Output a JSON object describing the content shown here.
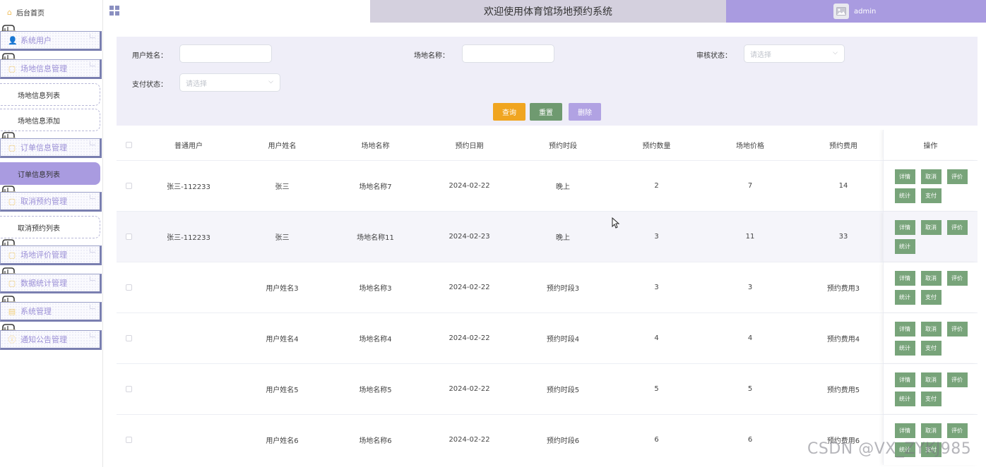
{
  "sidebar": {
    "home_label": "后台首页",
    "menus": [
      {
        "title": "系统用户",
        "icon": "user-icon",
        "items": []
      },
      {
        "title": "场地信息管理",
        "icon": "document-icon",
        "items": [
          "场地信息列表",
          "场地信息添加"
        ]
      },
      {
        "title": "订单信息管理",
        "icon": "document-icon",
        "items": [
          "订单信息列表"
        ]
      },
      {
        "title": "取消预约管理",
        "icon": "document-icon",
        "items": [
          "取消预约列表"
        ]
      },
      {
        "title": "场地评价管理",
        "icon": "document-icon",
        "items": []
      },
      {
        "title": "数据统计管理",
        "icon": "document-icon",
        "items": []
      },
      {
        "title": "系统管理",
        "icon": "grid-icon",
        "items": []
      },
      {
        "title": "通知公告管理",
        "icon": "info-icon",
        "items": []
      }
    ],
    "active_item": "订单信息列表"
  },
  "header": {
    "title": "欢迎使用体育馆场地预约系统",
    "username": "admin"
  },
  "search": {
    "user_name_label": "用户姓名：",
    "user_name_value": "",
    "venue_name_label": "场地名称：",
    "venue_name_value": "",
    "review_status_label": "审核状态：",
    "review_status_placeholder": "请选择",
    "pay_status_label": "支付状态：",
    "pay_status_placeholder": "请选择",
    "query_label": "查询",
    "reset_label": "重置",
    "delete_label": "删除"
  },
  "colors": {
    "accent": "#a99be0",
    "query": "#f0a520",
    "reset": "#6f9a70",
    "delete": "#b1a2e3",
    "op_button": "#78a47a"
  },
  "table": {
    "headers": [
      "普通用户",
      "用户姓名",
      "场地名称",
      "预约日期",
      "预约时段",
      "预约数量",
      "场地价格",
      "预约费用",
      "操作"
    ],
    "rows": [
      {
        "user": "张三-112233",
        "name": "张三",
        "venue": "场地名称7",
        "date": "2024-02-22",
        "slot": "晚上",
        "qty": "2",
        "price": "7",
        "fee": "14",
        "ops": [
          "详情",
          "取消",
          "评价",
          "统计",
          "支付"
        ]
      },
      {
        "user": "张三-112233",
        "name": "张三",
        "venue": "场地名称11",
        "date": "2024-02-23",
        "slot": "晚上",
        "qty": "3",
        "price": "11",
        "fee": "33",
        "ops": [
          "详情",
          "取消",
          "评价",
          "统计"
        ]
      },
      {
        "user": "",
        "name": "用户姓名3",
        "venue": "场地名称3",
        "date": "2024-02-22",
        "slot": "预约时段3",
        "qty": "3",
        "price": "3",
        "fee": "预约费用3",
        "ops": [
          "详情",
          "取消",
          "评价",
          "统计",
          "支付"
        ]
      },
      {
        "user": "",
        "name": "用户姓名4",
        "venue": "场地名称4",
        "date": "2024-02-22",
        "slot": "预约时段4",
        "qty": "4",
        "price": "4",
        "fee": "预约费用4",
        "ops": [
          "详情",
          "取消",
          "评价",
          "统计",
          "支付"
        ]
      },
      {
        "user": "",
        "name": "用户姓名5",
        "venue": "场地名称5",
        "date": "2024-02-22",
        "slot": "预约时段5",
        "qty": "5",
        "price": "5",
        "fee": "预约费用5",
        "ops": [
          "详情",
          "取消",
          "评价",
          "统计",
          "支付"
        ]
      },
      {
        "user": "",
        "name": "用户姓名6",
        "venue": "场地名称6",
        "date": "2024-02-22",
        "slot": "预约时段6",
        "qty": "6",
        "price": "6",
        "fee": "预约费用6",
        "ops": [
          "详情",
          "取消",
          "评价",
          "统计",
          "支付"
        ]
      }
    ]
  },
  "watermark": "CSDN @VX_ZYKJ985"
}
